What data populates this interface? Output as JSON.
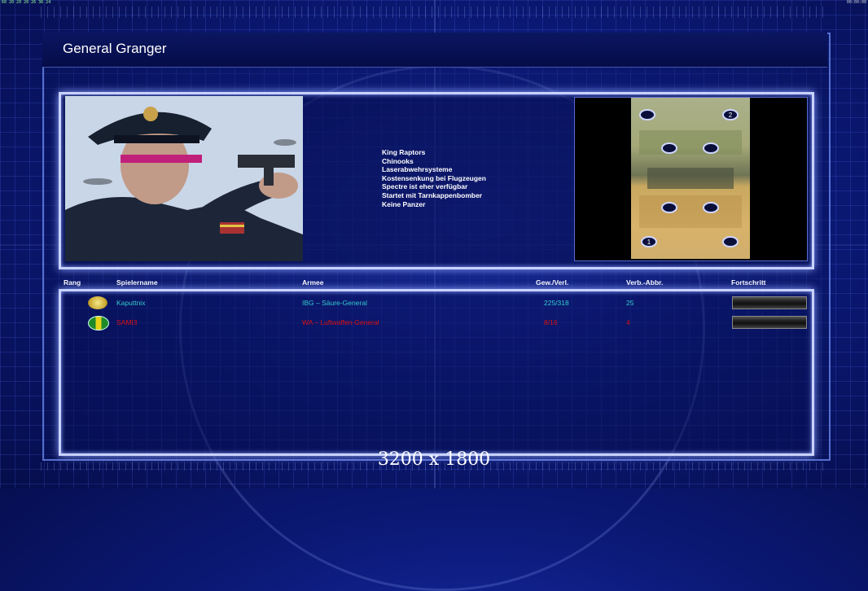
{
  "status": {
    "left": "60 20 20 20 26 36 24",
    "right": "00:00:00"
  },
  "title": "General Granger",
  "features": [
    "King Raptors",
    "Chinooks",
    "Laserabwehrsysteme",
    "Kostensenkung bei Flugzeugen",
    "Spectre ist eher verfügbar",
    "Startet mit Tarnkappenbomber",
    "Keine Panzer"
  ],
  "map": {
    "spawn_labels": [
      "1",
      "2"
    ]
  },
  "table": {
    "headers": [
      "Rang",
      "Spielername",
      "Armee",
      "Gew./Verl.",
      "Verb.-Abbr.",
      "Fortschritt"
    ],
    "rows": [
      {
        "player": "Kaputtnix",
        "army": "IBG – Säure-General",
        "wins_losses": "225/318",
        "disconnects": "25",
        "color": "#33cccc",
        "rank_icon": "gold-rank-icon"
      },
      {
        "player": "SAMI3",
        "army": "WA – Luftwaffen-General",
        "wins_losses": "8/16",
        "disconnects": "4",
        "color": "#dd1111",
        "rank_icon": "green-rank-icon"
      }
    ]
  },
  "resolution": "3200 x 1800",
  "colors": {
    "accent": "#c8d2ff",
    "background": "#0c1a7a"
  }
}
